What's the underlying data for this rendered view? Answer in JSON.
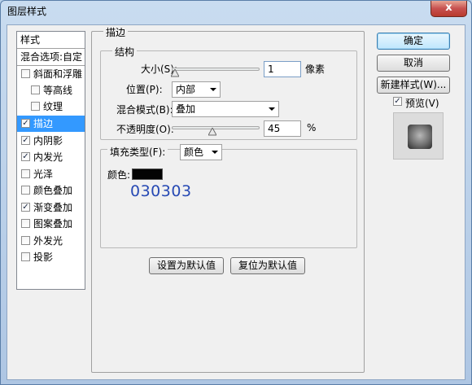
{
  "window": {
    "title": "图层样式",
    "close_label": "x"
  },
  "style_list": {
    "header": "样式",
    "blend_options": "混合选项:自定",
    "items": [
      {
        "label": "斜面和浮雕",
        "checked": false
      },
      {
        "label": "等高线",
        "checked": false
      },
      {
        "label": "纹理",
        "checked": false
      },
      {
        "label": "描边",
        "checked": true
      },
      {
        "label": "内阴影",
        "checked": true
      },
      {
        "label": "内发光",
        "checked": true
      },
      {
        "label": "光泽",
        "checked": false
      },
      {
        "label": "颜色叠加",
        "checked": false
      },
      {
        "label": "渐变叠加",
        "checked": true
      },
      {
        "label": "图案叠加",
        "checked": false
      },
      {
        "label": "外发光",
        "checked": false
      },
      {
        "label": "投影",
        "checked": false
      }
    ]
  },
  "stroke": {
    "title": "描边",
    "structure": {
      "title": "结构",
      "size_label": "大小(S):",
      "size_value": "1",
      "size_unit": "像素",
      "position_label": "位置(P):",
      "position_value": "内部",
      "blend_mode_label": "混合模式(B):",
      "blend_mode_value": "叠加",
      "opacity_label": "不透明度(O):",
      "opacity_value": "45",
      "opacity_unit": "%",
      "opacity_level": 0.45,
      "size_level": 0.01
    },
    "fill": {
      "fill_type_label": "填充类型(F):",
      "fill_type_value": "颜色",
      "color_label": "颜色:",
      "color_hex": "030303",
      "color_swatch": "#030303"
    },
    "set_default_label": "设置为默认值",
    "reset_default_label": "复位为默认值"
  },
  "actions": {
    "ok_label": "确定",
    "cancel_label": "取消",
    "new_style_label": "新建样式(W)...",
    "preview_label": "预览(V)",
    "preview_checked": true
  },
  "colors": {
    "selection": "#3399ff",
    "accent_text": "#2649b4"
  }
}
